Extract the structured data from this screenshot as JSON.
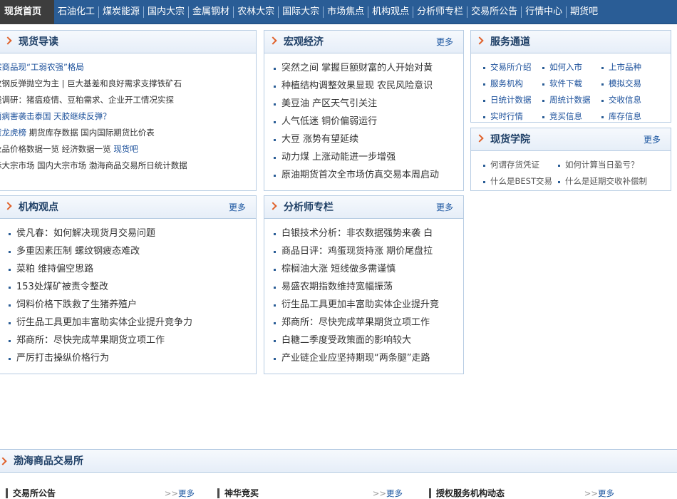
{
  "nav": {
    "home": "现货首页",
    "items": [
      "石油化工",
      "煤炭能源",
      "国内大宗",
      "金属钢材",
      "农林大宗",
      "国际大宗",
      "市场焦点",
      "机构观点",
      "分析师专栏",
      "交易所公告",
      "行情中心",
      "期货吧"
    ]
  },
  "guide": {
    "title": "现货导读",
    "lines": [
      {
        "a": "宗商品现“工弱农强”格局",
        "b": ""
      },
      {
        "a": "纹钢反弹抛空为主 | 巨大基差和良好需求支撑铁矿石",
        "b": ""
      },
      {
        "a": "线调研：猪瘟疫情、豆粕需求、企业开工情况实探",
        "b": ""
      },
      {
        "a": "菌病害袭击泰国 天胶继续反弹？",
        "b": ""
      },
      {
        "a": "货龙虎榜",
        "b": " 期货库存数据 国内国际期货比价表"
      },
      {
        "a": "业品价格数据一览 经济数据一览 ",
        "b": "现货吧"
      },
      {
        "a": "际大宗市场 国内大宗市场 渤海商品交易所日统计数据",
        "b": ""
      }
    ]
  },
  "macro": {
    "title": "宏观经济",
    "more": "更多",
    "items": [
      "突然之间 掌握巨额财富的人开始对黄",
      "种植结构调整效果显现 农民风险意识",
      "美豆油 产区天气引关注",
      "人气低迷 铜价偏弱运行",
      "大豆 涨势有望延续",
      "动力煤 上涨动能进一步增强",
      "原油期货首次全市场仿真交易本周启动"
    ]
  },
  "service": {
    "title": "服务通道",
    "items": [
      "交易所介绍",
      "如何入市",
      "上市品种",
      "服务机构",
      "软件下载",
      "模拟交易",
      "日统计数据",
      "周统计数据",
      "交收信息",
      "实时行情",
      "竞买信息",
      "库存信息"
    ]
  },
  "academy": {
    "title": "现货学院",
    "more": "更多",
    "rows": [
      [
        "何谓存货凭证",
        "如何计算当日盈亏？"
      ],
      [
        "什么是BEST交易",
        "什么是延期交收补偿制"
      ]
    ]
  },
  "institution": {
    "title": "机构观点",
    "more": "更多",
    "items": [
      "侯凡春：如何解决现货月交易问题",
      "多重因素压制 螺纹钢疲态难改",
      "菜粕 维持偏空思路",
      "153处煤矿被责令整改",
      "饲料价格下跌救了生猪养殖户",
      "衍生品工具更加丰富助实体企业提升竞争力",
      "郑商所：尽快完成苹果期货立项工作",
      "严厉打击操纵价格行为"
    ]
  },
  "analyst": {
    "title": "分析师专栏",
    "more": "更多",
    "items": [
      "白银技术分析：非农数据强势来袭 白",
      "商品日评：鸡蛋现货持涨 期价尾盘拉",
      "棕榈油大涨 短线做多需谨慎",
      "易盛农期指数维持宽幅振荡",
      "衍生品工具更加丰富助实体企业提升竞",
      "郑商所：尽快完成苹果期货立项工作",
      "白糖二季度受政策面的影响较大",
      "产业链企业应坚持期现“两条腿”走路"
    ]
  },
  "bohai": {
    "title": "渤海商品交易所",
    "subs": [
      {
        "label": "交易所公告",
        "more": "更多"
      },
      {
        "label": "神华竞买",
        "more": "更多"
      },
      {
        "label": "授权服务机构动态",
        "more": "更多"
      }
    ]
  }
}
